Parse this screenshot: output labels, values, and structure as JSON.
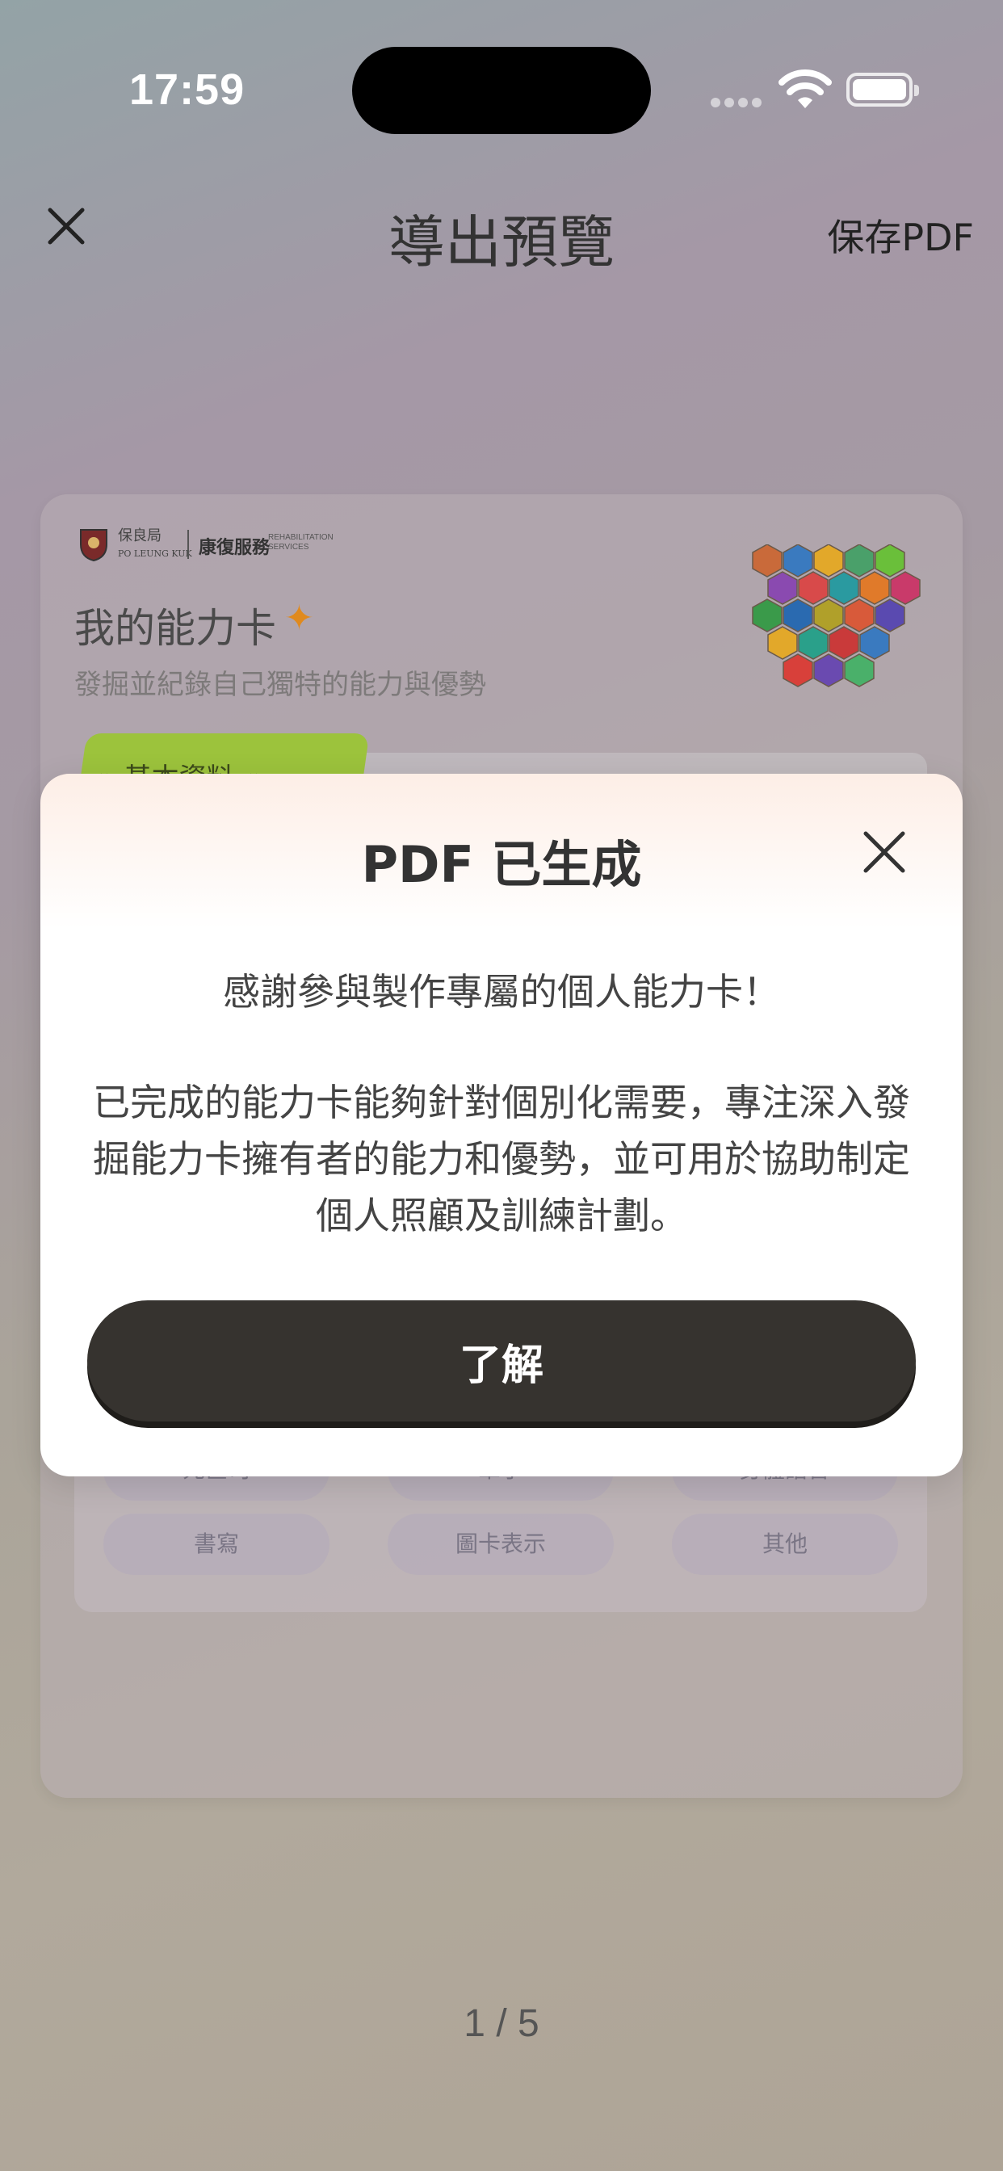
{
  "status_bar": {
    "time": "17:59"
  },
  "nav": {
    "title": "導出預覽",
    "save_label": "保存PDF"
  },
  "card": {
    "logo": {
      "org_zh": "保良局",
      "org_en": "PO LEUNG KUK",
      "service": "康復服務",
      "service_en_1": "REHABILITATION",
      "service_en_2": "SERVICES"
    },
    "title": "我的能力卡",
    "subtitle": "發掘並紀錄自己獨特的能力與優勢",
    "tab_label": "» 基本資料 «",
    "chips_row1": [
      "元筐司",
      "筆子",
      "身體語言"
    ],
    "chips_row2": [
      "書寫",
      "圖卡表示",
      "其他"
    ]
  },
  "modal": {
    "title": "PDF 已生成",
    "line1": "感謝參與製作專屬的個人能力卡！",
    "body": "已完成的能力卡能夠針對個別化需要，專注深入發掘能力卡擁有者的能力和優勢，並可用於協助制定個人照顧及訓練計劃。",
    "button_label": "了解"
  },
  "pager": "1 / 5",
  "colors": {
    "accent_green": "#9cc33c",
    "button_dark": "#36332f",
    "sparkle": "#e08a1e"
  }
}
